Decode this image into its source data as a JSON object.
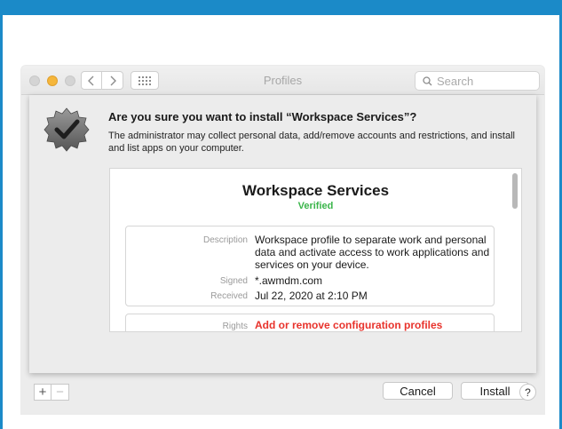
{
  "window": {
    "title": "Profiles",
    "search_placeholder": "Search"
  },
  "sheet": {
    "heading": "Are you sure you want to install “Workspace Services”?",
    "body": "The administrator may collect personal data, add/remove accounts and restrictions, and install and list apps on your computer."
  },
  "profile": {
    "name": "Workspace Services",
    "status": "Verified",
    "description_label": "Description",
    "description": "Workspace profile to separate work and personal data and activate access to work applications and services on your device.",
    "signed_label": "Signed",
    "signed": "*.awmdm.com",
    "received_label": "Received",
    "received": "Jul 22, 2020 at 2:10 PM",
    "rights_label": "Rights",
    "rights": "Add or remove configuration profiles"
  },
  "buttons": {
    "cancel": "Cancel",
    "install": "Install",
    "add": "+",
    "remove": "−",
    "help": "?"
  },
  "colors": {
    "frame": "#1b8ac8",
    "verified": "#3ab54a",
    "rights": "#e8332c",
    "minimize": "#f5b63b"
  }
}
